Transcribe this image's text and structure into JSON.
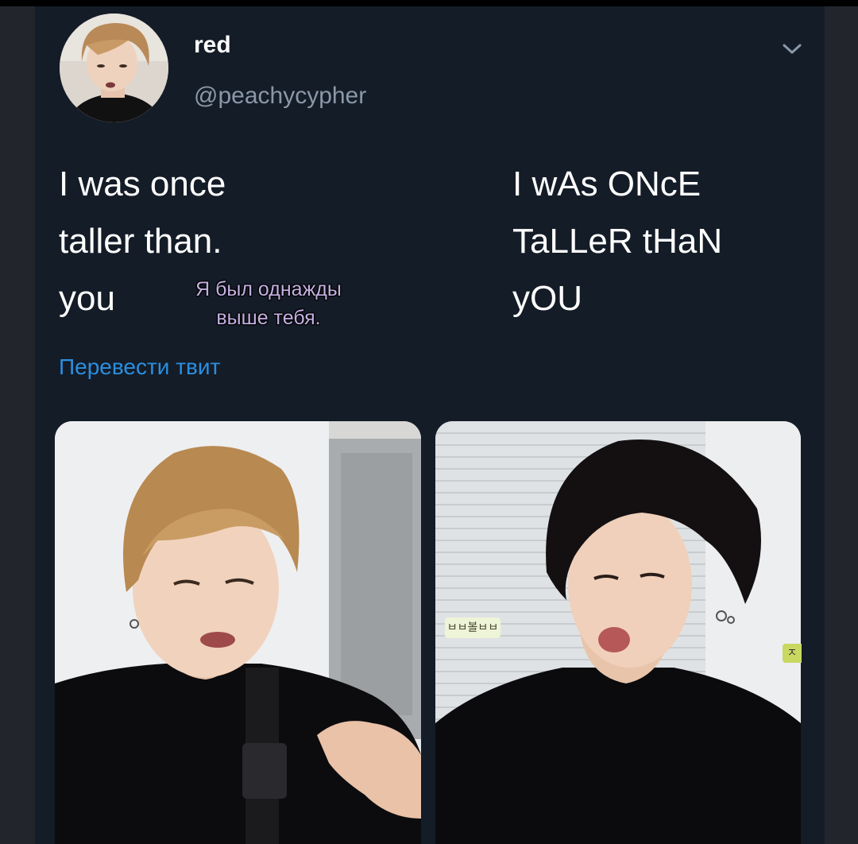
{
  "tweet": {
    "author_name": "red",
    "author_handle": "@peachycypher",
    "text_left": [
      "I was once",
      "taller than.",
      "you"
    ],
    "text_right": [
      "I wAs ONcE",
      "TaLLeR tHaN",
      "yOU"
    ],
    "overlay_translation": [
      "Я был однажды",
      "выше тебя."
    ],
    "translate_link": "Перевести твит"
  },
  "photos": {
    "right_caption": "ㅂㅂ볼ㅂㅂ",
    "right_edge_caption": "ㅈ"
  },
  "colors": {
    "card_bg": "#141c27",
    "link": "#2a8fe0",
    "handle": "#8a98a8",
    "overlay_text": "#c4b0e2"
  },
  "icons": {
    "menu": "chevron-down-icon"
  }
}
